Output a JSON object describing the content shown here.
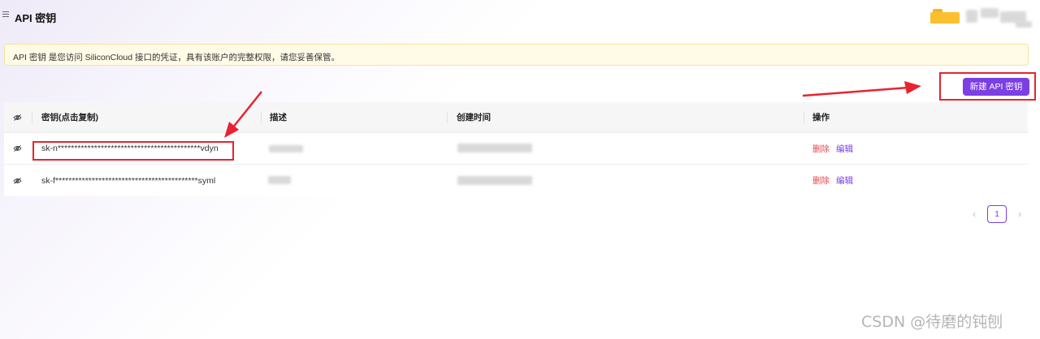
{
  "header": {
    "title": "API 密钥",
    "menu_icon": "menu-icon",
    "user_icon": "folder-icon"
  },
  "notice": {
    "text": "API 密钥 是您访问 SiliconCloud 接口的凭证，具有该账户的完整权限，请您妥善保管。"
  },
  "toolbar": {
    "new_key_label": "新建 API 密钥"
  },
  "table": {
    "columns": {
      "toggle_icon": "eye-off-icon",
      "key": "密钥(点击复制)",
      "description": "描述",
      "created": "创建时间",
      "actions": "操作"
    },
    "rows": [
      {
        "key": "sk-n*******************************************vdyn",
        "delete_label": "删除",
        "edit_label": "编辑"
      },
      {
        "key": "sk-f*******************************************syml",
        "delete_label": "删除",
        "edit_label": "编辑"
      }
    ]
  },
  "pagination": {
    "current_page": "1",
    "prev_icon": "chevron-left-icon",
    "next_icon": "chevron-right-icon"
  },
  "watermark": "CSDN @待磨的钝刨",
  "colors": {
    "accent": "#7b3fe4",
    "delete": "#e5484d",
    "notice_bg": "#fffbe6",
    "annotation": "#e8232f"
  }
}
